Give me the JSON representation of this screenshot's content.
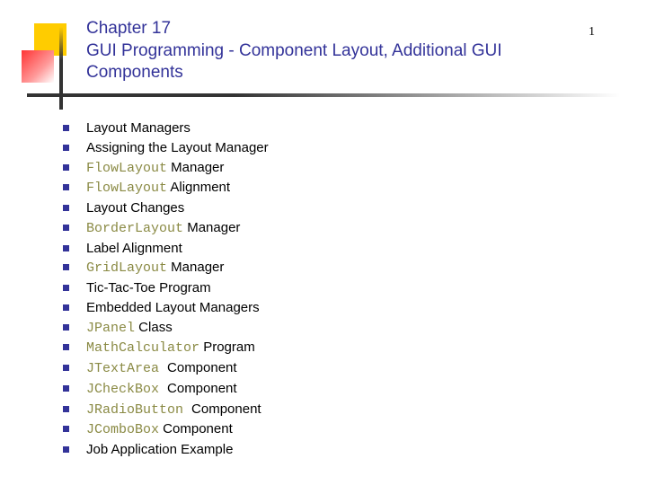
{
  "slide": {
    "number": "1",
    "chapter_line": "Chapter 17",
    "title_line": "GUI Programming - Component Layout, Additional GUI Components"
  },
  "topics": [
    {
      "parts": [
        {
          "text": "Layout Managers",
          "code": false
        }
      ]
    },
    {
      "parts": [
        {
          "text": "Assigning the Layout Manager",
          "code": false
        }
      ]
    },
    {
      "parts": [
        {
          "text": "FlowLayout",
          "code": true
        },
        {
          "text": " Manager",
          "code": false
        }
      ]
    },
    {
      "parts": [
        {
          "text": "FlowLayout",
          "code": true
        },
        {
          "text": " Alignment",
          "code": false
        }
      ]
    },
    {
      "parts": [
        {
          "text": "Layout Changes",
          "code": false
        }
      ]
    },
    {
      "parts": [
        {
          "text": "BorderLayout",
          "code": true
        },
        {
          "text": " Manager",
          "code": false
        }
      ]
    },
    {
      "parts": [
        {
          "text": "Label Alignment",
          "code": false
        }
      ]
    },
    {
      "parts": [
        {
          "text": "GridLayout",
          "code": true
        },
        {
          "text": " Manager",
          "code": false
        }
      ]
    },
    {
      "parts": [
        {
          "text": "Tic-Tac-Toe Program",
          "code": false
        }
      ]
    },
    {
      "parts": [
        {
          "text": "Embedded Layout Managers",
          "code": false
        }
      ]
    },
    {
      "parts": [
        {
          "text": "JPanel",
          "code": true
        },
        {
          "text": " Class",
          "code": false
        }
      ]
    },
    {
      "parts": [
        {
          "text": "MathCalculator",
          "code": true
        },
        {
          "text": " Program",
          "code": false
        }
      ]
    },
    {
      "parts": [
        {
          "text": "JTextArea ",
          "code": true
        },
        {
          "text": " Component",
          "code": false
        }
      ]
    },
    {
      "parts": [
        {
          "text": "JCheckBox ",
          "code": true
        },
        {
          "text": " Component",
          "code": false
        }
      ]
    },
    {
      "parts": [
        {
          "text": "JRadioButton ",
          "code": true
        },
        {
          "text": " Component",
          "code": false
        }
      ]
    },
    {
      "parts": [
        {
          "text": "JComboBox",
          "code": true
        },
        {
          "text": " Component",
          "code": false
        }
      ]
    },
    {
      "parts": [
        {
          "text": "Job Application Example",
          "code": false
        }
      ]
    }
  ]
}
